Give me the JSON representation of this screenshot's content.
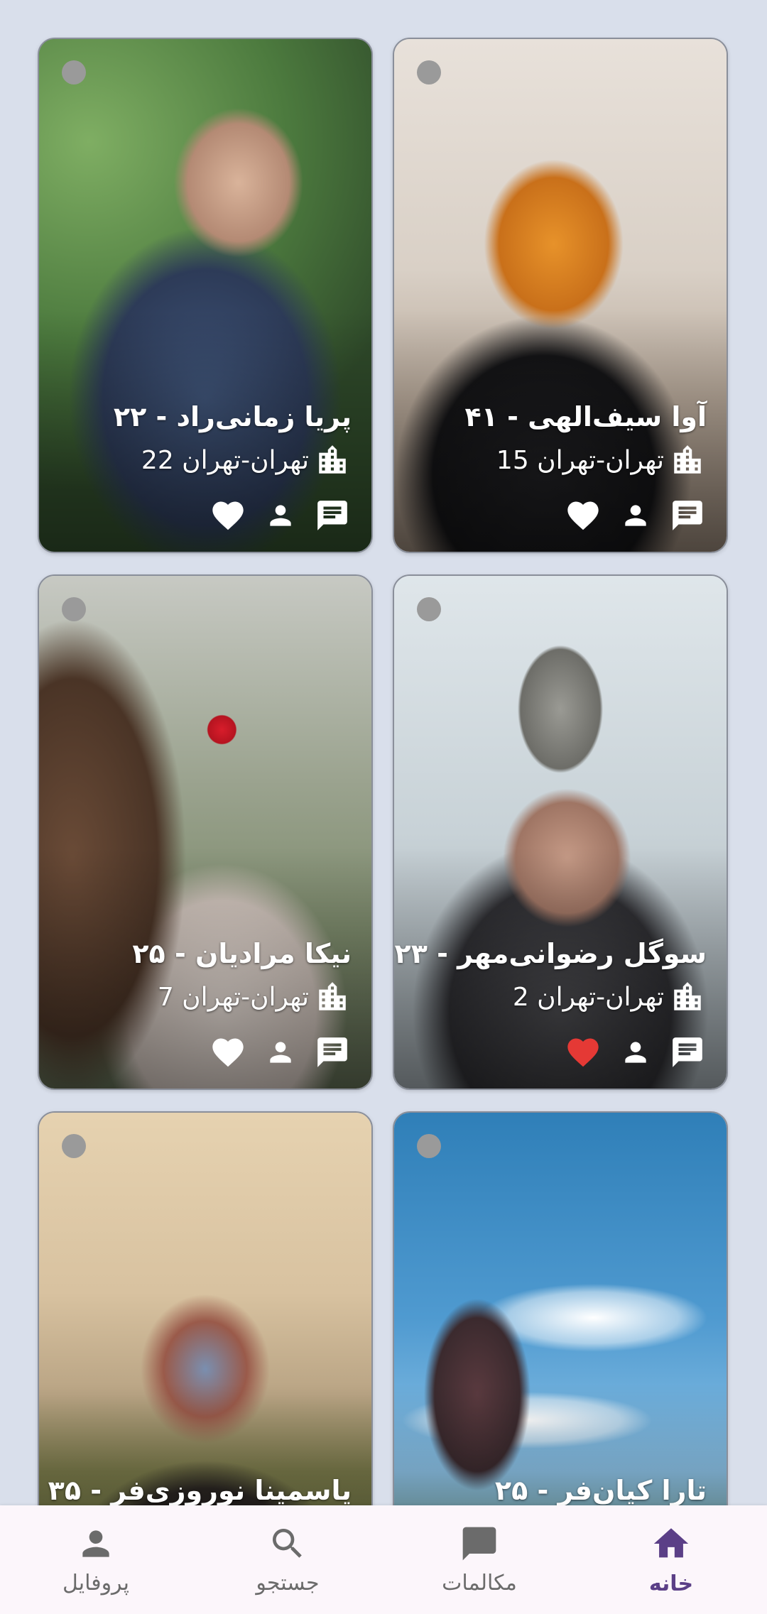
{
  "profiles": [
    {
      "name": "پریا زمانی‌راد - ۲۲",
      "location": "تهران-تهران 22",
      "liked": false
    },
    {
      "name": "آوا سیف‌الهی - ۴۱",
      "location": "تهران-تهران 15",
      "liked": false
    },
    {
      "name": "نیکا مرادیان - ۲۵",
      "location": "تهران-تهران 7",
      "liked": false
    },
    {
      "name": "سوگل رضوانی‌مهر - ۲۳",
      "location": "تهران-تهران 2",
      "liked": true
    },
    {
      "name": "یاسمینا نوروزی‌فر - ۳۵",
      "location": "",
      "liked": false
    },
    {
      "name": "تارا کیان‌فر - ۲۵",
      "location": "",
      "liked": false
    }
  ],
  "colors": {
    "background": "#d9dfeb",
    "nav_background": "#fcf6fb",
    "nav_active": "#5b3f87",
    "nav_inactive": "#6b6b6b",
    "like_active": "#e53935",
    "status_dot": "#9a9a9a"
  },
  "nav": {
    "home_label": "خانه",
    "chats_label": "مکالمات",
    "search_label": "جستجو",
    "profile_label": "پروفایل",
    "active": "home"
  },
  "icons": {
    "location": "city-buildings-icon",
    "like": "heart-icon",
    "profile": "person-icon",
    "message": "chat-icon",
    "nav_home": "home-icon",
    "nav_chats": "chat-bubble-icon",
    "nav_search": "search-icon",
    "nav_profile": "person-icon"
  }
}
